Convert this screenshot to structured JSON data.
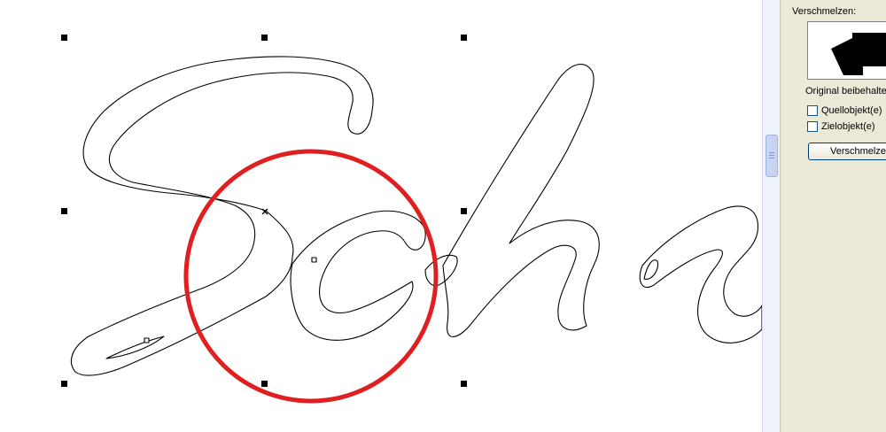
{
  "panel": {
    "section_title": "Verschmelzen:",
    "keep_original_label": "Original beibehalte",
    "source_label": "Quellobjekt(e)",
    "target_label": "Zielobjekt(e)",
    "merge_button_label": "Verschmelzen",
    "source_checked": false,
    "target_checked": false
  },
  "canvas": {
    "highlight_color": "#e02020",
    "outline_color": "#000000"
  }
}
